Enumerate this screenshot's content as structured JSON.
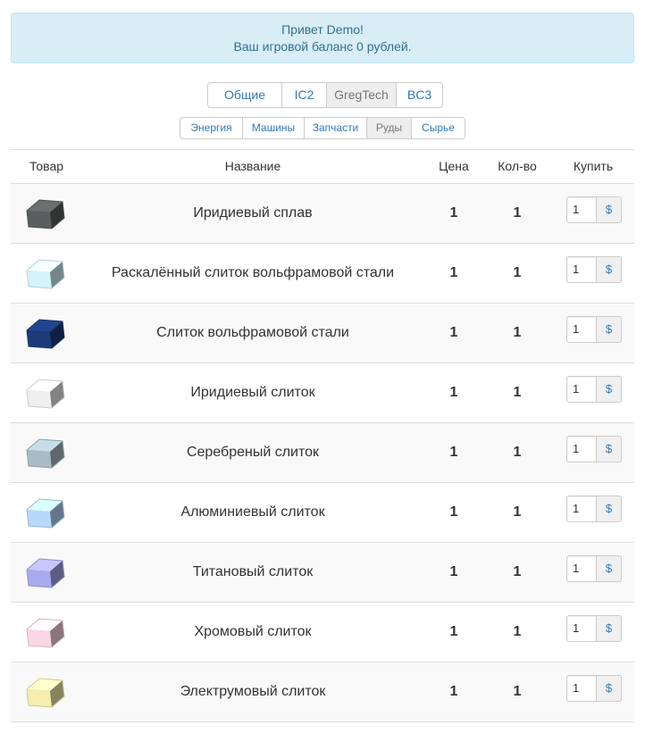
{
  "alert": {
    "greeting": "Привет Demo!",
    "balance": "Ваш игровой баланс 0 рублей."
  },
  "mod_tabs": [
    {
      "label": "Общие",
      "active": false
    },
    {
      "label": "IC2",
      "active": false
    },
    {
      "label": "GregTech",
      "active": true
    },
    {
      "label": "BC3",
      "active": false
    }
  ],
  "category_tabs": [
    {
      "label": "Энергия",
      "active": false
    },
    {
      "label": "Машины",
      "active": false
    },
    {
      "label": "Запчасти",
      "active": false
    },
    {
      "label": "Руды",
      "active": true
    },
    {
      "label": "Сырье",
      "active": false
    }
  ],
  "table": {
    "headers": {
      "item": "Товар",
      "name": "Название",
      "price": "Цена",
      "qty": "Кол-во",
      "buy": "Купить"
    },
    "buy_button_label": "$",
    "rows": [
      {
        "name": "Иридиевый сплав",
        "price": "1",
        "qty": "1",
        "amount": "1",
        "icon": "iridium-alloy-icon",
        "color": "#5a5e5e"
      },
      {
        "name": "Раскалённый слиток вольфрамовой стали",
        "price": "1",
        "qty": "1",
        "amount": "1",
        "icon": "hot-tungstensteel-ingot-icon",
        "color": "#d2f4fb"
      },
      {
        "name": "Слиток вольфрамовой стали",
        "price": "1",
        "qty": "1",
        "amount": "1",
        "icon": "tungstensteel-ingot-icon",
        "color": "#1c3a78"
      },
      {
        "name": "Иридиевый слиток",
        "price": "1",
        "qty": "1",
        "amount": "1",
        "icon": "iridium-ingot-icon",
        "color": "#efefef"
      },
      {
        "name": "Серебреный слиток",
        "price": "1",
        "qty": "1",
        "amount": "1",
        "icon": "silver-ingot-icon",
        "color": "#a9bcc6"
      },
      {
        "name": "Алюминиевый слиток",
        "price": "1",
        "qty": "1",
        "amount": "1",
        "icon": "aluminium-ingot-icon",
        "color": "#b8d8fb"
      },
      {
        "name": "Титановый слиток",
        "price": "1",
        "qty": "1",
        "amount": "1",
        "icon": "titanium-ingot-icon",
        "color": "#a9a9ee"
      },
      {
        "name": "Хромовый слиток",
        "price": "1",
        "qty": "1",
        "amount": "1",
        "icon": "chrome-ingot-icon",
        "color": "#fbd6e4"
      },
      {
        "name": "Электрумовый слиток",
        "price": "1",
        "qty": "1",
        "amount": "1",
        "icon": "electrum-ingot-icon",
        "color": "#f5eeae"
      }
    ]
  }
}
